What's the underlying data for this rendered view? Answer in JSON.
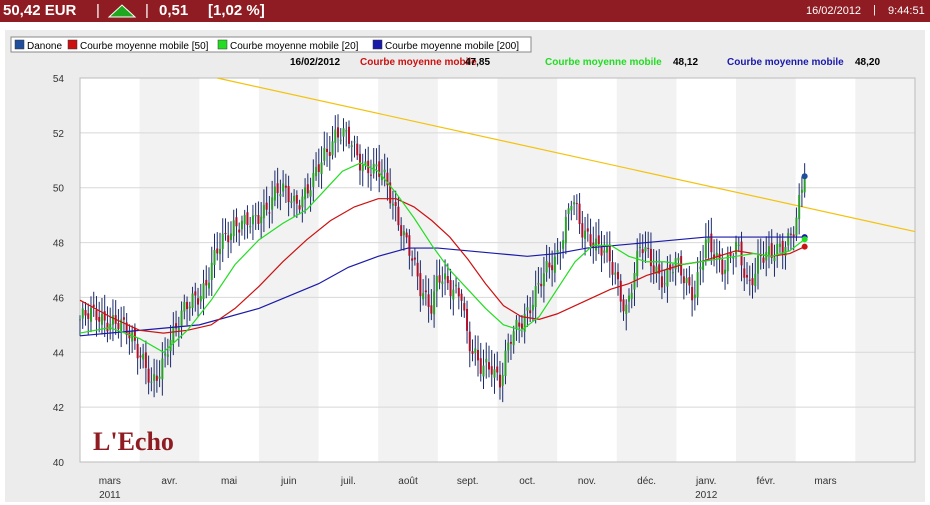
{
  "header": {
    "price": "50,42 EUR",
    "separator": "|",
    "change": "0,51",
    "change_pct": "[1,02 %]",
    "date": "16/02/2012",
    "time_sep": "|",
    "time": "9:44:51",
    "trend_icon": "up-arrow-icon",
    "colors": {
      "bar": "#8e1c22",
      "arrow": "#1fa81f"
    }
  },
  "chart_data": {
    "type": "candlestick",
    "logo": "L'Echo",
    "legend": [
      {
        "name": "Danone",
        "color": "#1f4e9c"
      },
      {
        "name": "Courbe moyenne mobile  [50]",
        "color": "#cc1111"
      },
      {
        "name": "Courbe moyenne mobile  [20]",
        "color": "#22dd22"
      },
      {
        "name": "Courbe moyenne mobile  [200]",
        "color": "#1a1aaa"
      }
    ],
    "info_date": "16/02/2012",
    "info": [
      {
        "label": "Courbe moyenne mobile",
        "value": "47,85",
        "color": "#cc1111"
      },
      {
        "label": "Courbe moyenne mobile",
        "value": "48,12",
        "color": "#22dd22"
      },
      {
        "label": "Courbe moyenne mobile",
        "value": "48,20",
        "color": "#1a1aaa"
      }
    ],
    "ylim": [
      40,
      54
    ],
    "yticks": [
      40,
      42,
      44,
      46,
      48,
      50,
      52,
      54
    ],
    "x_range": [
      0,
      14
    ],
    "months": [
      {
        "label": "mars",
        "x": 0.5
      },
      {
        "label": "avr.",
        "x": 1.5
      },
      {
        "label": "mai",
        "x": 2.5
      },
      {
        "label": "juin",
        "x": 3.5
      },
      {
        "label": "juil.",
        "x": 4.5
      },
      {
        "label": "août",
        "x": 5.5
      },
      {
        "label": "sept.",
        "x": 6.5
      },
      {
        "label": "oct.",
        "x": 7.5
      },
      {
        "label": "nov.",
        "x": 8.5
      },
      {
        "label": "déc.",
        "x": 9.5
      },
      {
        "label": "janv.",
        "x": 10.5
      },
      {
        "label": "févr.",
        "x": 11.5
      },
      {
        "label": "mars",
        "x": 12.5
      }
    ],
    "years": [
      {
        "label": "2011",
        "x": 0.5
      },
      {
        "label": "2012",
        "x": 10.5
      }
    ],
    "price_series": [
      [
        0.0,
        45.2
      ],
      [
        0.3,
        45.4
      ],
      [
        0.6,
        45.0
      ],
      [
        0.9,
        44.6
      ],
      [
        1.1,
        43.5
      ],
      [
        1.2,
        42.6
      ],
      [
        1.35,
        43.3
      ],
      [
        1.5,
        44.6
      ],
      [
        1.8,
        45.6
      ],
      [
        2.1,
        46.5
      ],
      [
        2.3,
        47.6
      ],
      [
        2.6,
        48.8
      ],
      [
        2.9,
        48.6
      ],
      [
        3.1,
        49.3
      ],
      [
        3.3,
        49.9
      ],
      [
        3.6,
        49.5
      ],
      [
        3.9,
        50.1
      ],
      [
        4.1,
        51.2
      ],
      [
        4.3,
        52.1
      ],
      [
        4.5,
        51.7
      ],
      [
        4.7,
        51.0
      ],
      [
        4.9,
        50.7
      ],
      [
        5.1,
        50.3
      ],
      [
        5.3,
        49.2
      ],
      [
        5.5,
        47.8
      ],
      [
        5.7,
        46.3
      ],
      [
        5.9,
        45.8
      ],
      [
        6.0,
        46.8
      ],
      [
        6.2,
        46.2
      ],
      [
        6.4,
        46.3
      ],
      [
        6.5,
        44.5
      ],
      [
        6.7,
        43.3
      ],
      [
        6.9,
        43.6
      ],
      [
        7.05,
        43.0
      ],
      [
        7.2,
        44.3
      ],
      [
        7.5,
        45.6
      ],
      [
        7.8,
        46.8
      ],
      [
        8.0,
        47.6
      ],
      [
        8.25,
        49.6
      ],
      [
        8.4,
        48.4
      ],
      [
        8.6,
        48.2
      ],
      [
        8.8,
        47.6
      ],
      [
        9.0,
        46.6
      ],
      [
        9.15,
        45.6
      ],
      [
        9.4,
        47.8
      ],
      [
        9.6,
        47.3
      ],
      [
        9.8,
        46.6
      ],
      [
        10.0,
        47.2
      ],
      [
        10.3,
        46.2
      ],
      [
        10.5,
        47.9
      ],
      [
        10.8,
        47.2
      ],
      [
        11.0,
        47.8
      ],
      [
        11.2,
        46.4
      ],
      [
        11.4,
        47.6
      ],
      [
        11.6,
        47.4
      ],
      [
        11.8,
        48.0
      ],
      [
        12.0,
        48.7
      ],
      [
        12.15,
        50.42
      ]
    ],
    "ma20": [
      [
        0.0,
        44.7
      ],
      [
        0.5,
        44.9
      ],
      [
        1.0,
        44.5
      ],
      [
        1.4,
        44.0
      ],
      [
        1.8,
        44.8
      ],
      [
        2.2,
        45.9
      ],
      [
        2.6,
        47.2
      ],
      [
        3.0,
        48.1
      ],
      [
        3.4,
        48.7
      ],
      [
        3.8,
        49.2
      ],
      [
        4.1,
        49.9
      ],
      [
        4.4,
        50.6
      ],
      [
        4.7,
        50.9
      ],
      [
        5.0,
        50.6
      ],
      [
        5.3,
        49.8
      ],
      [
        5.6,
        48.9
      ],
      [
        5.9,
        47.9
      ],
      [
        6.2,
        47.0
      ],
      [
        6.5,
        46.3
      ],
      [
        6.8,
        45.6
      ],
      [
        7.1,
        45.0
      ],
      [
        7.4,
        44.8
      ],
      [
        7.7,
        45.3
      ],
      [
        8.0,
        46.3
      ],
      [
        8.3,
        47.3
      ],
      [
        8.6,
        47.9
      ],
      [
        8.9,
        47.9
      ],
      [
        9.2,
        47.5
      ],
      [
        9.5,
        47.3
      ],
      [
        9.8,
        47.3
      ],
      [
        10.1,
        47.2
      ],
      [
        10.4,
        47.3
      ],
      [
        10.7,
        47.4
      ],
      [
        11.0,
        47.5
      ],
      [
        11.3,
        47.6
      ],
      [
        11.6,
        47.5
      ],
      [
        11.9,
        47.7
      ],
      [
        12.15,
        48.12
      ]
    ],
    "ma50": [
      [
        0.0,
        45.9
      ],
      [
        0.5,
        45.3
      ],
      [
        1.0,
        44.8
      ],
      [
        1.4,
        44.7
      ],
      [
        1.8,
        44.8
      ],
      [
        2.2,
        45.0
      ],
      [
        2.6,
        45.6
      ],
      [
        3.0,
        46.4
      ],
      [
        3.4,
        47.3
      ],
      [
        3.8,
        48.1
      ],
      [
        4.2,
        48.8
      ],
      [
        4.6,
        49.3
      ],
      [
        5.0,
        49.6
      ],
      [
        5.3,
        49.6
      ],
      [
        5.6,
        49.3
      ],
      [
        5.9,
        48.8
      ],
      [
        6.2,
        48.2
      ],
      [
        6.5,
        47.4
      ],
      [
        6.8,
        46.5
      ],
      [
        7.1,
        45.7
      ],
      [
        7.4,
        45.3
      ],
      [
        7.7,
        45.2
      ],
      [
        8.0,
        45.4
      ],
      [
        8.3,
        45.7
      ],
      [
        8.6,
        46.0
      ],
      [
        8.9,
        46.3
      ],
      [
        9.2,
        46.5
      ],
      [
        9.5,
        46.8
      ],
      [
        9.8,
        47.0
      ],
      [
        10.1,
        47.2
      ],
      [
        10.4,
        47.3
      ],
      [
        10.7,
        47.5
      ],
      [
        11.0,
        47.7
      ],
      [
        11.3,
        47.6
      ],
      [
        11.6,
        47.5
      ],
      [
        11.9,
        47.6
      ],
      [
        12.15,
        47.85
      ]
    ],
    "ma200": [
      [
        0.0,
        44.6
      ],
      [
        1.0,
        44.8
      ],
      [
        2.0,
        45.0
      ],
      [
        3.0,
        45.6
      ],
      [
        4.0,
        46.5
      ],
      [
        4.5,
        47.1
      ],
      [
        5.0,
        47.5
      ],
      [
        5.5,
        47.8
      ],
      [
        6.0,
        47.8
      ],
      [
        6.5,
        47.7
      ],
      [
        7.0,
        47.6
      ],
      [
        7.5,
        47.5
      ],
      [
        8.0,
        47.6
      ],
      [
        8.5,
        47.8
      ],
      [
        9.0,
        47.9
      ],
      [
        9.5,
        48.0
      ],
      [
        10.0,
        48.1
      ],
      [
        10.5,
        48.2
      ],
      [
        11.0,
        48.2
      ],
      [
        11.5,
        48.2
      ],
      [
        12.15,
        48.2
      ]
    ],
    "trendline": [
      [
        2.3,
        54.0
      ],
      [
        14.0,
        48.4
      ]
    ]
  }
}
